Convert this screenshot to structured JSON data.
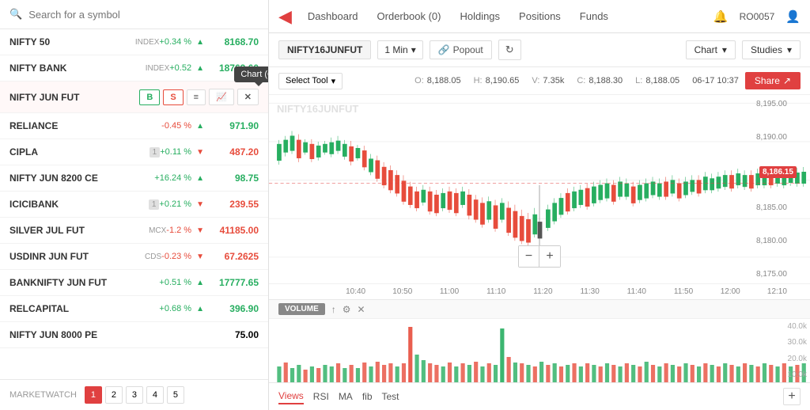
{
  "sidebar": {
    "search_placeholder": "Search for a symbol",
    "items": [
      {
        "name": "NIFTY 50",
        "badge": "INDEX",
        "change": "+0.34 %",
        "direction": "up",
        "price": "8168.70"
      },
      {
        "name": "NIFTY BANK",
        "badge": "INDEX",
        "change": "+0.52",
        "direction": "up",
        "price": "18763.60"
      },
      {
        "name": "NIFTY JUN FUT",
        "badge": "",
        "change": "",
        "direction": "",
        "price": ""
      },
      {
        "name": "RELIANCE",
        "badge": "",
        "change": "-0.45 %",
        "direction": "down",
        "price": "971.90"
      },
      {
        "name": "CIPLA",
        "badge": "1",
        "change": "+0.11 %",
        "direction": "down",
        "price": "487.20"
      },
      {
        "name": "NIFTY JUN 8200 CE",
        "badge": "",
        "change": "+16.24 %",
        "direction": "up",
        "price": "98.75"
      },
      {
        "name": "ICICIBANK",
        "badge": "1",
        "change": "+0.21 %",
        "direction": "down",
        "price": "239.55"
      },
      {
        "name": "SILVER JUL FUT",
        "badge": "MCX",
        "change": "-1.2 %",
        "direction": "down",
        "price": "41185.00"
      },
      {
        "name": "USDINR JUN FUT",
        "badge": "CDS",
        "change": "-0.23 %",
        "direction": "down",
        "price": "67.2625"
      },
      {
        "name": "BANKNIFTY JUN FUT",
        "badge": "",
        "change": "+0.51 %",
        "direction": "up",
        "price": "17777.65"
      },
      {
        "name": "RELCAPITAL",
        "badge": "",
        "change": "+0.68 %",
        "direction": "up",
        "price": "396.90"
      },
      {
        "name": "NIFTY JUN 8000 PE",
        "badge": "",
        "change": "",
        "direction": "",
        "price": "75.00"
      }
    ],
    "active_item_index": 2,
    "action_buttons": {
      "buy": "B",
      "sell": "S",
      "menu": "≡",
      "chart": "📈",
      "close": "✕"
    },
    "tooltip": "Chart (C)",
    "pagination": {
      "label": "MARKETWATCH",
      "pages": [
        "1",
        "2",
        "3",
        "4",
        "5"
      ]
    }
  },
  "navbar": {
    "logo": "◀",
    "links": [
      {
        "label": "Dashboard"
      },
      {
        "label": "Orderbook (0)"
      },
      {
        "label": "Holdings"
      },
      {
        "label": "Positions"
      },
      {
        "label": "Funds"
      }
    ],
    "bell_icon": "🔔",
    "user_id": "RO0057",
    "user_icon": "👤"
  },
  "chart": {
    "symbol": "NIFTY16JUNFUT",
    "timeframe": "1 Min",
    "popout_label": "Popout",
    "chart_type": "Chart",
    "studies_label": "Studies",
    "tool_label": "Select Tool",
    "ohlc": {
      "open_label": "O:",
      "open": "8,188.05",
      "high_label": "H:",
      "high": "8,190.65",
      "volume_label": "V:",
      "volume": "7.35k",
      "close_label": "C:",
      "close": "8,188.30",
      "low_label": "L:",
      "low": "8,188.05",
      "date": "06-17 10:37"
    },
    "share_label": "Share",
    "watermark": "NIFTY16JUNFUT",
    "price_levels": [
      "8,195.00",
      "8,190.00",
      "8,185.00",
      "8,180.00",
      "8,175.00"
    ],
    "current_price": "8,186.15",
    "time_labels": [
      "10:40",
      "10:50",
      "11:00",
      "11:10",
      "11:20",
      "11:30",
      "11:40",
      "11:50",
      "12:00",
      "12:10"
    ],
    "zoom_minus": "−",
    "zoom_plus": "+",
    "volume": {
      "label": "VOLUME",
      "y_axis": [
        "40.0k",
        "30.0k",
        "20.0k",
        "10.0k"
      ]
    },
    "studies_tabs": [
      {
        "label": "Views",
        "active": true
      },
      {
        "label": "RSI"
      },
      {
        "label": "MA"
      },
      {
        "label": "fib"
      },
      {
        "label": "Test"
      }
    ],
    "add_tab_label": "+"
  }
}
